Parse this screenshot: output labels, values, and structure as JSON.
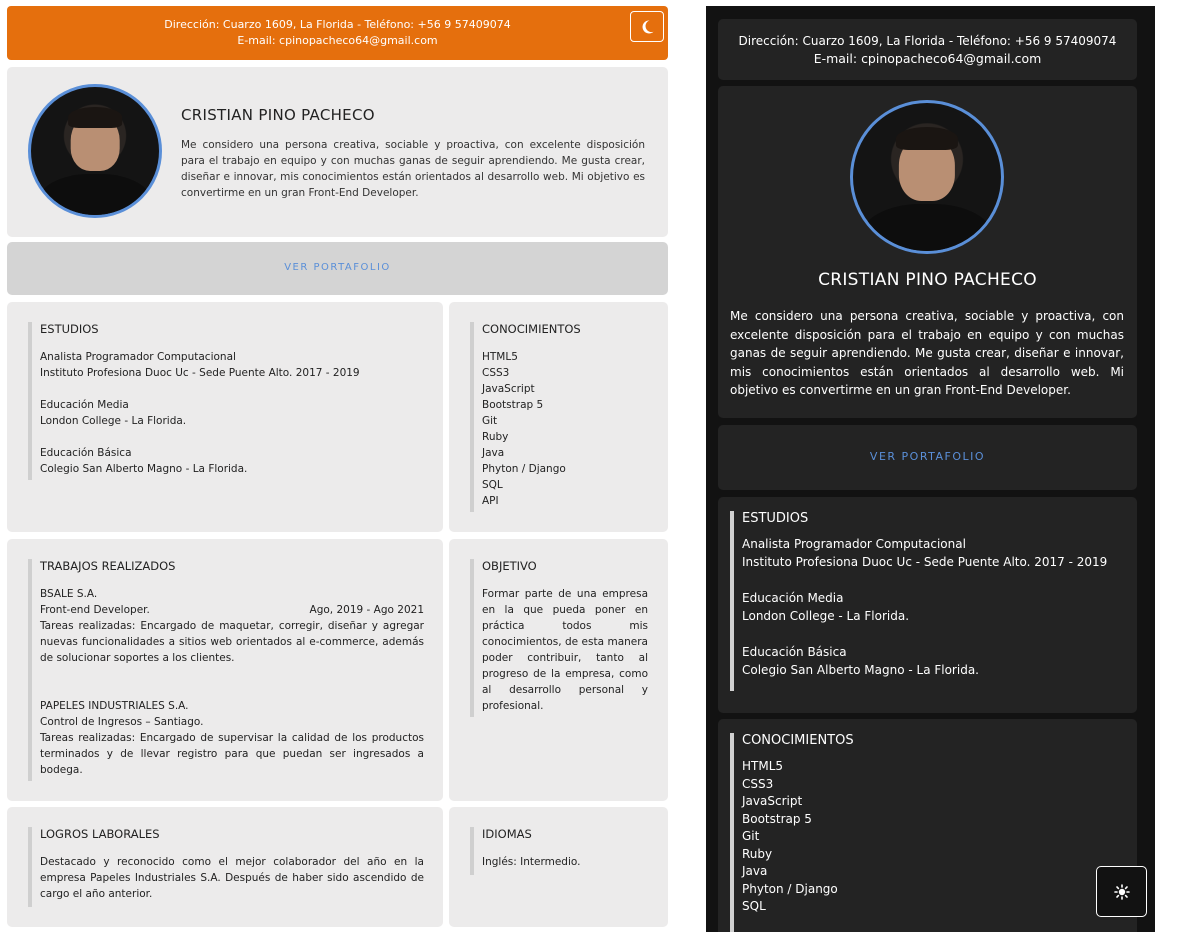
{
  "header": {
    "address": "Dirección: Cuarzo 1609, La Florida - Teléfono: +56 9 57409074",
    "email": "E-mail: cpinopacheco64@gmail.com"
  },
  "profile": {
    "name": "CRISTIAN PINO PACHECO",
    "bio": "Me considero una persona creativa, sociable y proactiva, con excelente disposición para el trabajo en equipo y con muchas ganas de seguir aprendiendo. Me gusta crear, diseñar e innovar, mis conocimientos están orientados al desarrollo web. Mi objetivo es convertirme en un gran Front-End Developer."
  },
  "portfolio_label": "VER PORTAFOLIO",
  "studies": {
    "title": "ESTUDIOS",
    "items": [
      {
        "degree": "Analista Programador Computacional",
        "place": "Instituto Profesiona Duoc Uc - Sede Puente Alto. 2017 - 2019"
      },
      {
        "degree": "Educación Media",
        "place": "London College - La Florida."
      },
      {
        "degree": "Educación Básica",
        "place": "Colegio San Alberto Magno - La Florida."
      }
    ]
  },
  "skills": {
    "title": "CONOCIMIENTOS",
    "items": [
      "HTML5",
      "CSS3",
      "JavaScript",
      "Bootstrap 5",
      "Git",
      "Ruby",
      "Java",
      "Phyton / Django",
      "SQL",
      "API"
    ]
  },
  "jobs": {
    "title": "TRABAJOS REALIZADOS",
    "items": [
      {
        "company": "BSALE S.A.",
        "role": "Front-end Developer.",
        "dates": "Ago, 2019 - Ago 2021",
        "description": "Tareas realizadas: Encargado de maquetar, corregir, diseñar y agregar nuevas funcionalidades a sitios web orientados al e-commerce, además de solucionar soportes a los clientes."
      },
      {
        "company": "PAPELES INDUSTRIALES S.A.",
        "role": "Control de Ingresos – Santiago.",
        "dates": "",
        "description": "Tareas realizadas: Encargado de supervisar la calidad de los productos terminados y de llevar registro para que puedan ser ingresados a bodega."
      }
    ]
  },
  "objective": {
    "title": "OBJETIVO",
    "text": "Formar parte de una empresa en la que pueda poner en práctica todos mis conocimientos, de esta manera poder contribuir, tanto al progreso de la empresa, como al desarrollo personal y profesional."
  },
  "achievements": {
    "title": "LOGROS LABORALES",
    "text": "Destacado y reconocido como el mejor colaborador del año en la empresa Papeles Industriales S.A. Después de haber sido ascendido de cargo el año anterior."
  },
  "languages": {
    "title": "IDIOMAS",
    "text": "Inglés: Intermedio."
  },
  "icons": {
    "theme_toggle_light": "moon-icon",
    "theme_toggle_dark": "sun-icon"
  },
  "colors": {
    "accent_orange": "#e56f0d",
    "link_blue": "#5a8fd8",
    "card_light": "#ecebeb",
    "card_dark": "#232323"
  }
}
